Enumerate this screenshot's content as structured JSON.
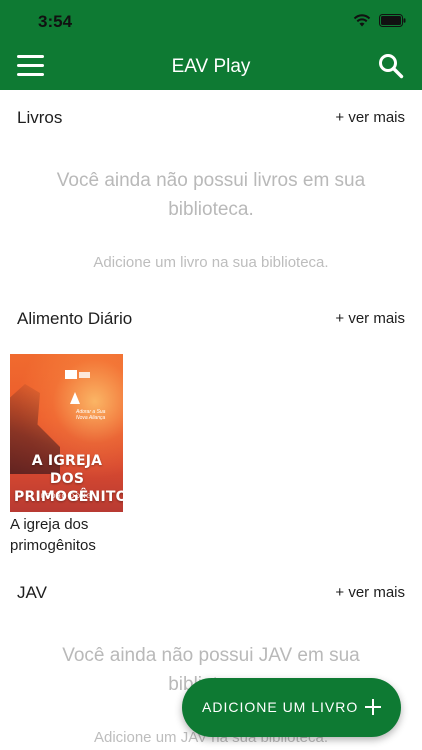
{
  "status_bar": {
    "time": "3:54"
  },
  "app_bar": {
    "title": "EAV Play"
  },
  "sections": [
    {
      "title": "Livros",
      "see_more": "+ ver mais",
      "empty_title": "Você ainda não possui livros em sua biblioteca.",
      "empty_sub": "Adicione um livro na sua biblioteca."
    },
    {
      "title": "Alimento Diário",
      "see_more": "+ ver mais",
      "items": [
        {
          "caption": "A igreja dos primogênitos",
          "cover_title": "A IGREJA DOS PRIMOGÊNITOS",
          "cover_author": "PEDRO DONG",
          "cover_publisher": "Adorar a Sua Nova Aliança"
        }
      ]
    },
    {
      "title": "JAV",
      "see_more": "+ ver mais",
      "empty_title": "Você ainda não possui JAV em sua biblioteca.",
      "empty_sub": "Adicione um JAV na sua biblioteca."
    }
  ],
  "fab": {
    "label": "ADICIONE UM LIVRO",
    "icon": "plus-icon"
  },
  "colors": {
    "brand_green": "#0e7a33",
    "muted_text": "#b9b9b9"
  }
}
